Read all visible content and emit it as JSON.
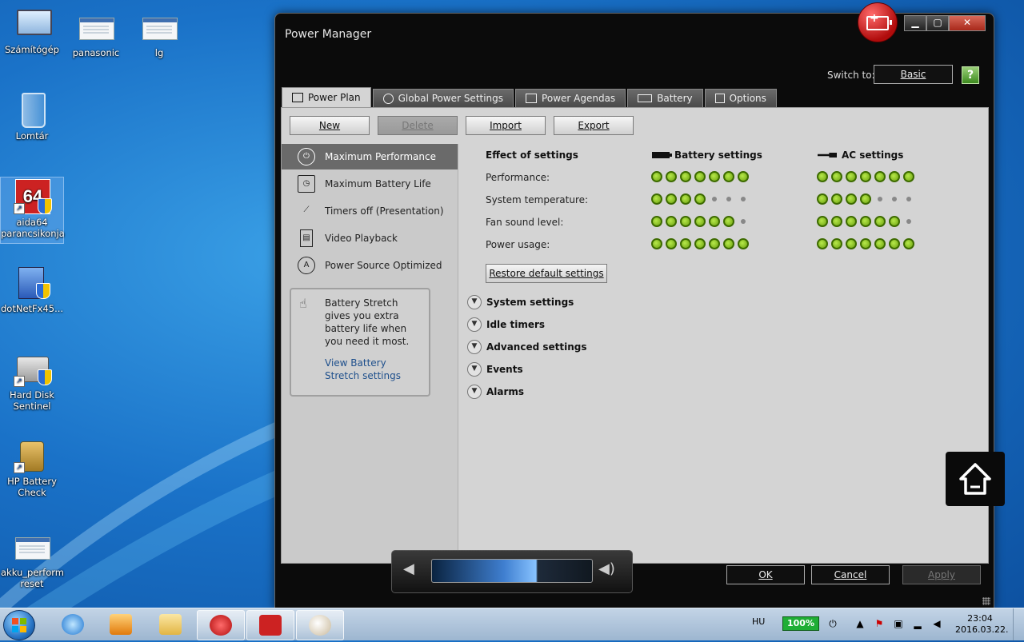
{
  "desktop": {
    "icons": [
      {
        "label": "Számítógép"
      },
      {
        "label": "panasonic"
      },
      {
        "label": "lg"
      },
      {
        "label": "Lomtár"
      },
      {
        "label": "aida64 parancsikonja"
      },
      {
        "label": "dotNetFx45..."
      },
      {
        "label": "Hard Disk Sentinel"
      },
      {
        "label": "HP Battery Check"
      },
      {
        "label": "akku_perform reset"
      }
    ]
  },
  "window": {
    "title": "Power Manager",
    "switch_label": "Switch to:",
    "switch_button": "Basic",
    "help_glyph": "?",
    "controls": {
      "minimize": "▁",
      "maximize": "▢",
      "close": "✕"
    },
    "tabs": [
      {
        "label": "Power Plan",
        "active": true
      },
      {
        "label": "Global Power Settings"
      },
      {
        "label": "Power Agendas"
      },
      {
        "label": "Battery"
      },
      {
        "label": "Options"
      }
    ],
    "toolbar": {
      "new": "New",
      "delete": "Delete",
      "import": "Import",
      "export": "Export"
    },
    "plans": [
      {
        "label": "Maximum Performance",
        "selected": true,
        "icon": "power-icon"
      },
      {
        "label": "Maximum Battery Life",
        "icon": "battery-clock-icon"
      },
      {
        "label": "Timers off (Presentation)",
        "icon": "projector-icon"
      },
      {
        "label": "Video Playback",
        "icon": "film-icon"
      },
      {
        "label": "Power Source Optimized",
        "icon": "auto-icon"
      }
    ],
    "stretch": {
      "text": "Battery Stretch gives you extra battery life when you need it most.",
      "link": "View Battery Stretch settings"
    },
    "effects": {
      "heading": "Effect of settings",
      "battery_heading": "Battery settings",
      "ac_heading": "AC settings",
      "metrics": [
        {
          "label": "Performance:",
          "battery": 7,
          "ac": 7
        },
        {
          "label": "System temperature:",
          "battery": 4,
          "ac": 4
        },
        {
          "label": "Fan sound level:",
          "battery": 6,
          "ac": 6
        },
        {
          "label": "Power usage:",
          "battery": 7,
          "ac": 7
        }
      ],
      "max_dots": 7,
      "restore_button": "Restore default settings"
    },
    "sections": [
      {
        "label": "System settings"
      },
      {
        "label": "Idle timers"
      },
      {
        "label": "Advanced settings"
      },
      {
        "label": "Events"
      },
      {
        "label": "Alarms"
      }
    ],
    "bottom": {
      "ok": "OK",
      "cancel": "Cancel",
      "apply": "Apply"
    }
  },
  "volume": {
    "level_percent": 65
  },
  "taskbar": {
    "language": "HU",
    "battery": "100%",
    "time": "23:04",
    "date": "2016.03.22."
  },
  "colors": {
    "desktop_blue": "#1a72c8",
    "window_black": "#0b0b0b",
    "panel_grey": "#d4d4d4",
    "dot_green": "#8cc63f",
    "link_blue": "#1e4f8c",
    "badge_red": "#c40f0f"
  }
}
